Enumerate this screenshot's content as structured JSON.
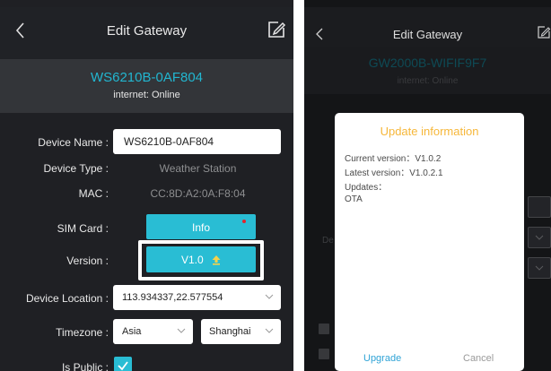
{
  "left": {
    "title": "Edit Gateway",
    "device_id": "WS6210B-0AF804",
    "status": "internet: Online",
    "fields": {
      "device_name_label": "Device Name :",
      "device_name_value": "WS6210B-0AF804",
      "device_type_label": "Device Type :",
      "device_type_value": "Weather Station",
      "mac_label": "MAC :",
      "mac_value": "CC:8D:A2:0A:F8:04",
      "sim_label": "SIM Card :",
      "sim_button": "Info",
      "version_label": "Version :",
      "version_button": "V1.0",
      "location_label": "Device Location :",
      "location_value": "113.934337,22.577554",
      "timezone_label": "Timezone :",
      "timezone_region": "Asia",
      "timezone_city": "Shanghai",
      "public_label": "Is Public :",
      "public_checked": true
    }
  },
  "right": {
    "title": "Edit Gateway",
    "device_id": "GW2000B-WIFIF9F7",
    "status": "internet: Online",
    "ghost_label": "De",
    "modal": {
      "title": "Update information",
      "current_version": "Current version：V1.0.2",
      "latest_version": "Latest version：V1.0.2.1",
      "updates_label": "Updates：",
      "updates_value": "OTA",
      "upgrade_button": "Upgrade",
      "cancel_button": "Cancel"
    }
  },
  "colors": {
    "accent": "#29bdd4",
    "device_id": "#22b6d0",
    "modal_title": "#f6b73a",
    "upgrade": "#2fa3d6",
    "notify_dot": "#e2242c"
  },
  "icons": {
    "back": "chevron-left-icon",
    "edit": "edit-icon",
    "upgrade": "arrow-up-icon",
    "dropdown": "chevron-down-icon",
    "checkbox": "check-icon"
  }
}
